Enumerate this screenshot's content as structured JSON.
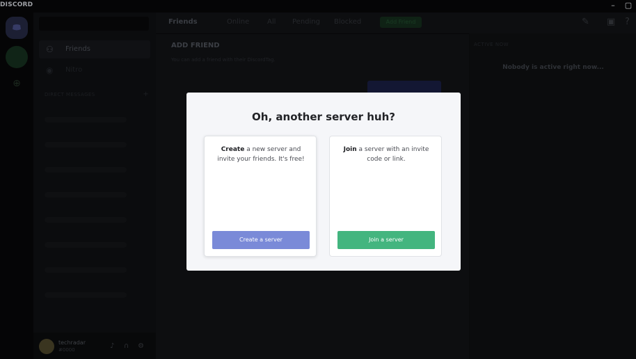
{
  "window": {
    "brand": "DISCORD",
    "minimize": "–",
    "maximize": "▢"
  },
  "friends_nav": {
    "friends": "Friends",
    "nitro": "Nitro",
    "direct_messages": "DIRECT MESSAGES"
  },
  "user": {
    "name": "techradar",
    "tag": "#0000"
  },
  "topbar": {
    "friends": "Friends",
    "online": "Online",
    "all": "All",
    "pending": "Pending",
    "blocked": "Blocked",
    "add_friend": "Add Friend"
  },
  "add_friend": {
    "title": "ADD FRIEND",
    "description": "You can add a friend with their DiscordTag."
  },
  "active_now": {
    "title": "ACTIVE NOW",
    "quiet": "Nobody is active right now..."
  },
  "modal": {
    "title": "Oh, another server huh?",
    "create": {
      "bold": "Create",
      "text": " a new server and invite your friends. It's free!",
      "button": "Create a server",
      "color": "#7a8ad8"
    },
    "join": {
      "bold": "Join",
      "text": " a server with an invite code or link.",
      "button": "Join a server",
      "color": "#43b57f"
    }
  }
}
